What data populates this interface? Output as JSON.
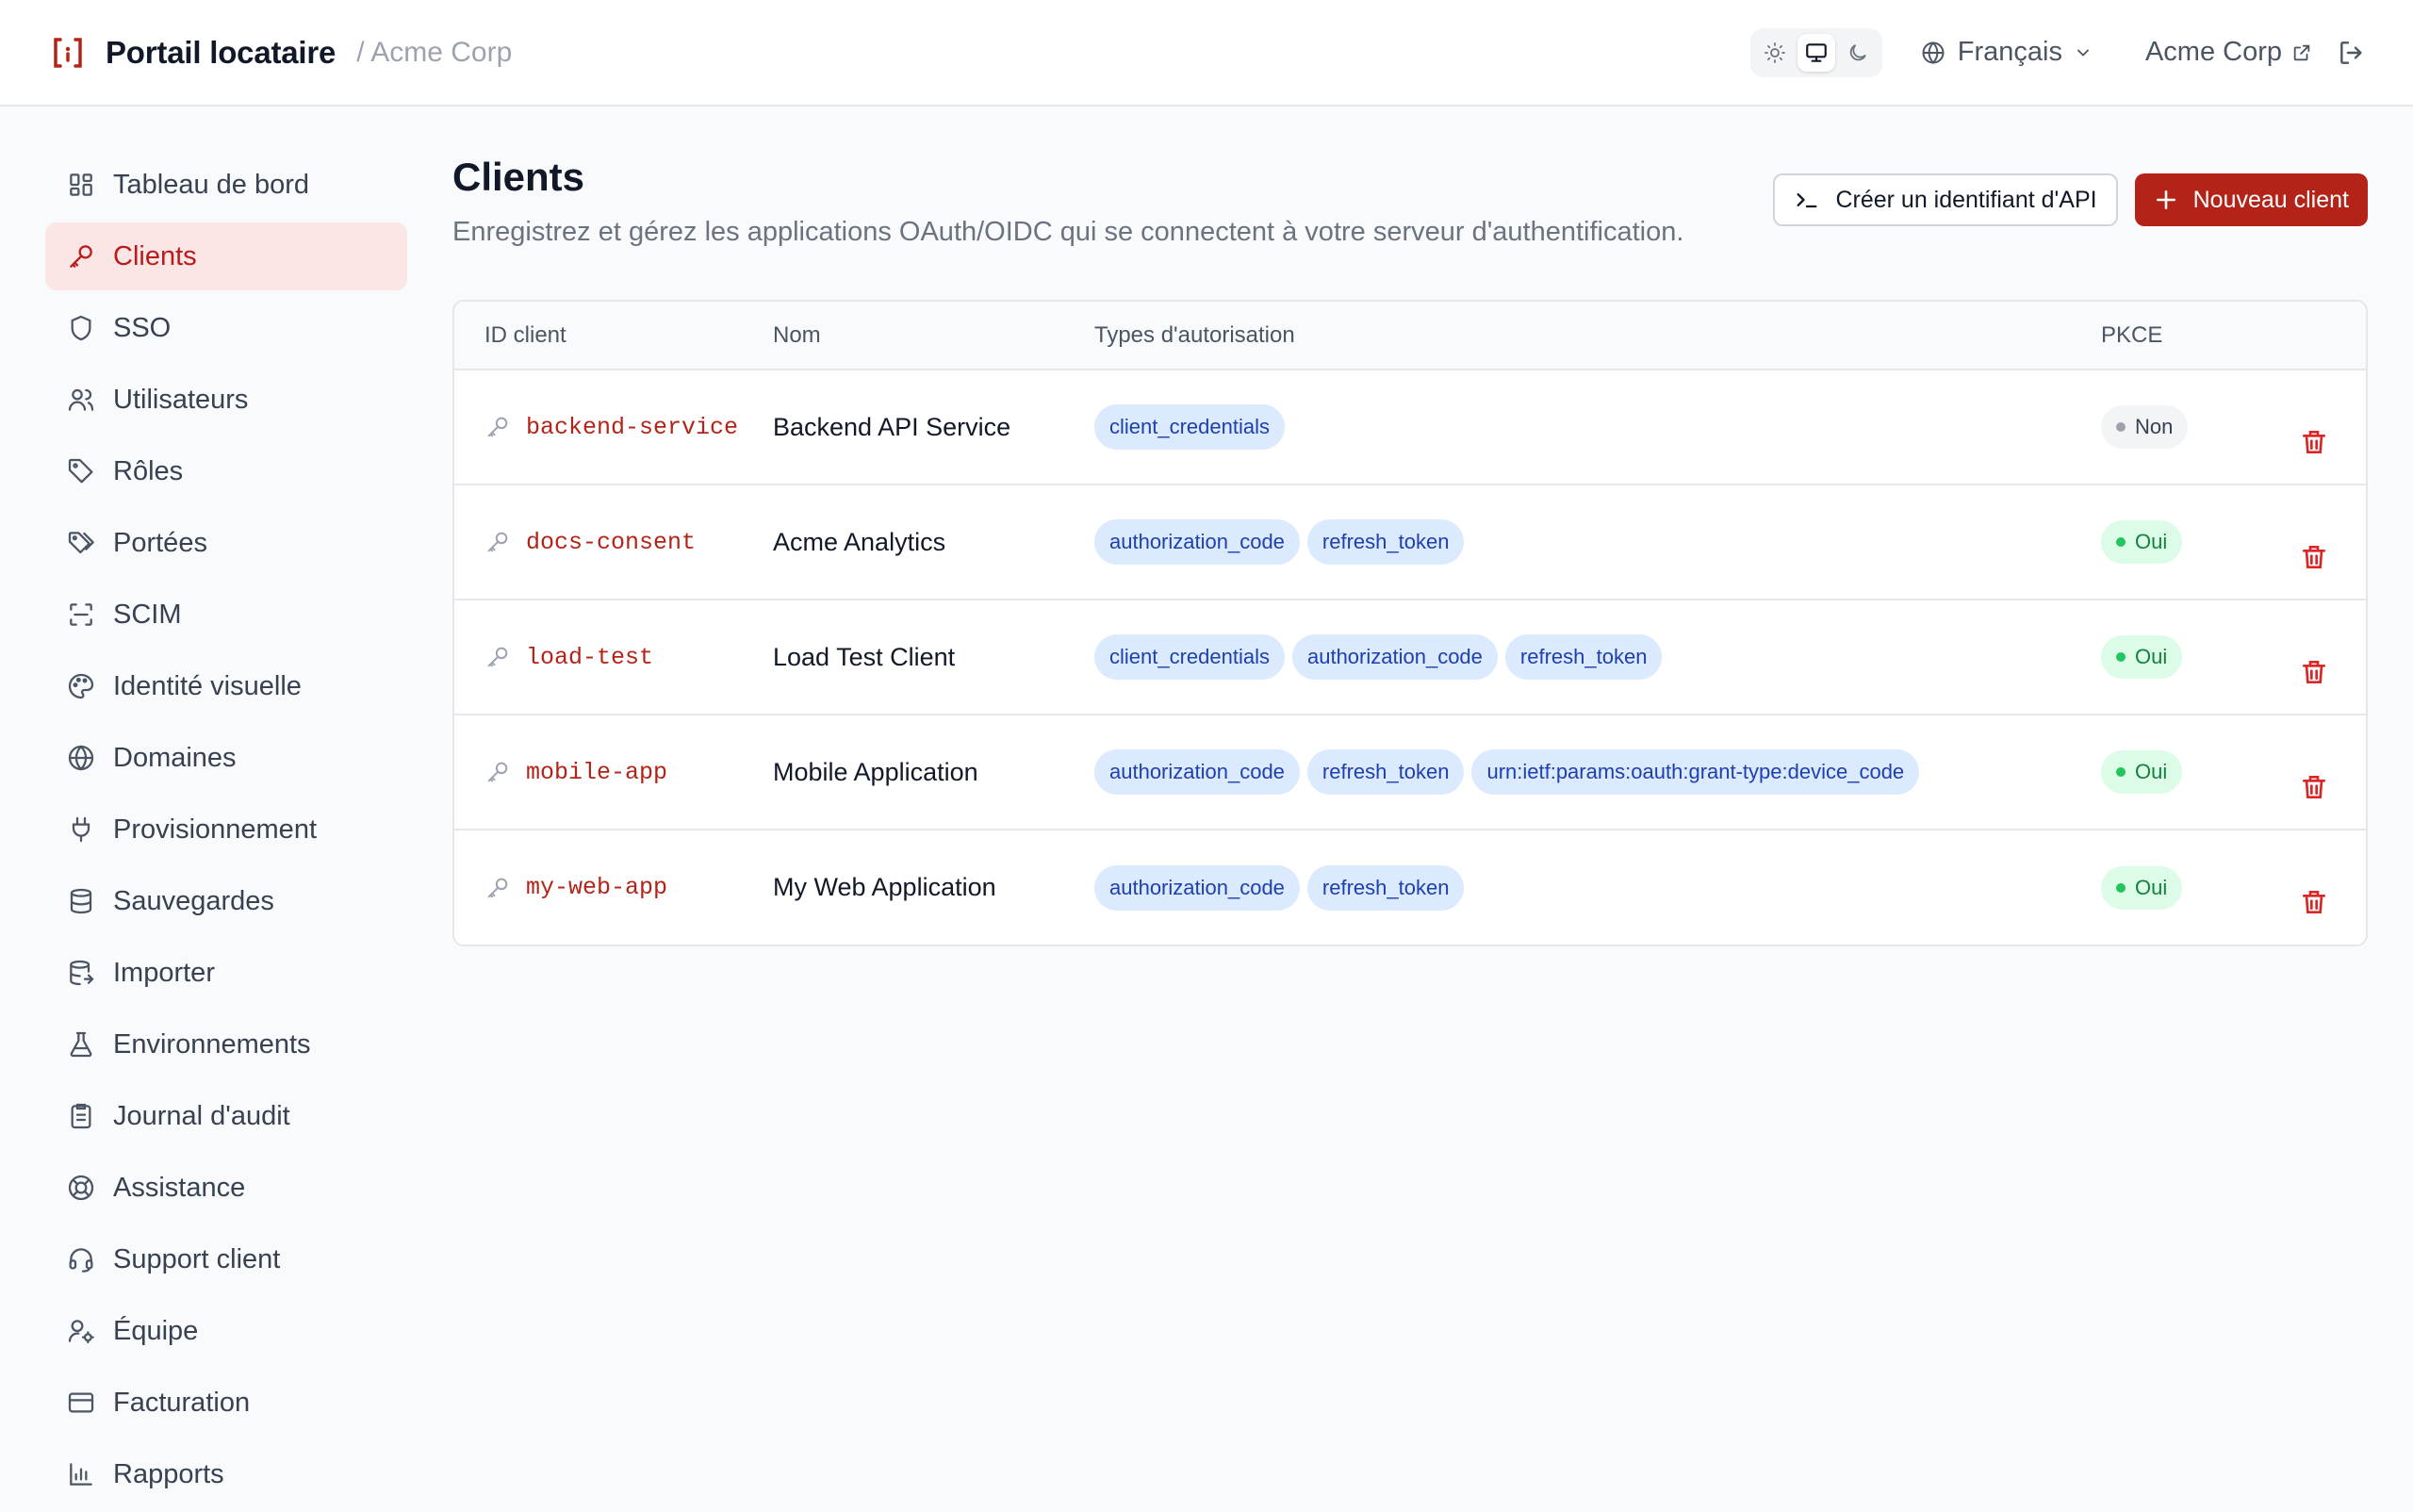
{
  "header": {
    "title": "Portail locataire",
    "breadcrumb": "/ Acme Corp",
    "language": "Français",
    "tenant": "Acme Corp",
    "theme_options": [
      "sun-icon",
      "monitor-icon",
      "moon-icon"
    ],
    "theme_selected": "monitor-icon"
  },
  "sidebar": {
    "items": [
      {
        "label": "Tableau de bord",
        "icon": "dashboard-icon"
      },
      {
        "label": "Clients",
        "icon": "key-icon",
        "active": true
      },
      {
        "label": "SSO",
        "icon": "shield-icon"
      },
      {
        "label": "Utilisateurs",
        "icon": "users-icon"
      },
      {
        "label": "Rôles",
        "icon": "tag-icon"
      },
      {
        "label": "Portées",
        "icon": "tags-icon"
      },
      {
        "label": "SCIM",
        "icon": "scan-icon"
      },
      {
        "label": "Identité visuelle",
        "icon": "palette-icon"
      },
      {
        "label": "Domaines",
        "icon": "globe-icon"
      },
      {
        "label": "Provisionnement",
        "icon": "plug-icon"
      },
      {
        "label": "Sauvegardes",
        "icon": "database-icon"
      },
      {
        "label": "Importer",
        "icon": "database-import-icon"
      },
      {
        "label": "Environnements",
        "icon": "flask-icon"
      },
      {
        "label": "Journal d'audit",
        "icon": "clipboard-icon"
      },
      {
        "label": "Assistance",
        "icon": "lifebuoy-icon"
      },
      {
        "label": "Support client",
        "icon": "headset-icon"
      },
      {
        "label": "Équipe",
        "icon": "user-cog-icon"
      },
      {
        "label": "Facturation",
        "icon": "credit-card-icon"
      },
      {
        "label": "Rapports",
        "icon": "bar-chart-icon"
      }
    ]
  },
  "page": {
    "title": "Clients",
    "subtitle": "Enregistrez et gérez les applications OAuth/OIDC qui se connectent à votre serveur d'authentification.",
    "create_api_label": "Créer un identifiant d'API",
    "new_client_label": "Nouveau client"
  },
  "table": {
    "columns": [
      "ID client",
      "Nom",
      "Types d'autorisation",
      "PKCE"
    ],
    "rows": [
      {
        "id": "backend-service",
        "name": "Backend API Service",
        "grants": [
          "client_credentials"
        ],
        "pkce": "Non",
        "pkce_on": false
      },
      {
        "id": "docs-consent",
        "name": "Acme Analytics",
        "grants": [
          "authorization_code",
          "refresh_token"
        ],
        "pkce": "Oui",
        "pkce_on": true
      },
      {
        "id": "load-test",
        "name": "Load Test Client",
        "grants": [
          "client_credentials",
          "authorization_code",
          "refresh_token"
        ],
        "pkce": "Oui",
        "pkce_on": true
      },
      {
        "id": "mobile-app",
        "name": "Mobile Application",
        "grants": [
          "authorization_code",
          "refresh_token",
          "urn:ietf:params:oauth:grant-type:device_code"
        ],
        "pkce": "Oui",
        "pkce_on": true
      },
      {
        "id": "my-web-app",
        "name": "My Web Application",
        "grants": [
          "authorization_code",
          "refresh_token"
        ],
        "pkce": "Oui",
        "pkce_on": true
      }
    ]
  },
  "colors": {
    "brand": "#b42318",
    "active_bg": "#fbe5e5",
    "chip_bg": "#dbeafe",
    "chip_text": "#1e40af",
    "pkce_yes": "#22c55e"
  }
}
